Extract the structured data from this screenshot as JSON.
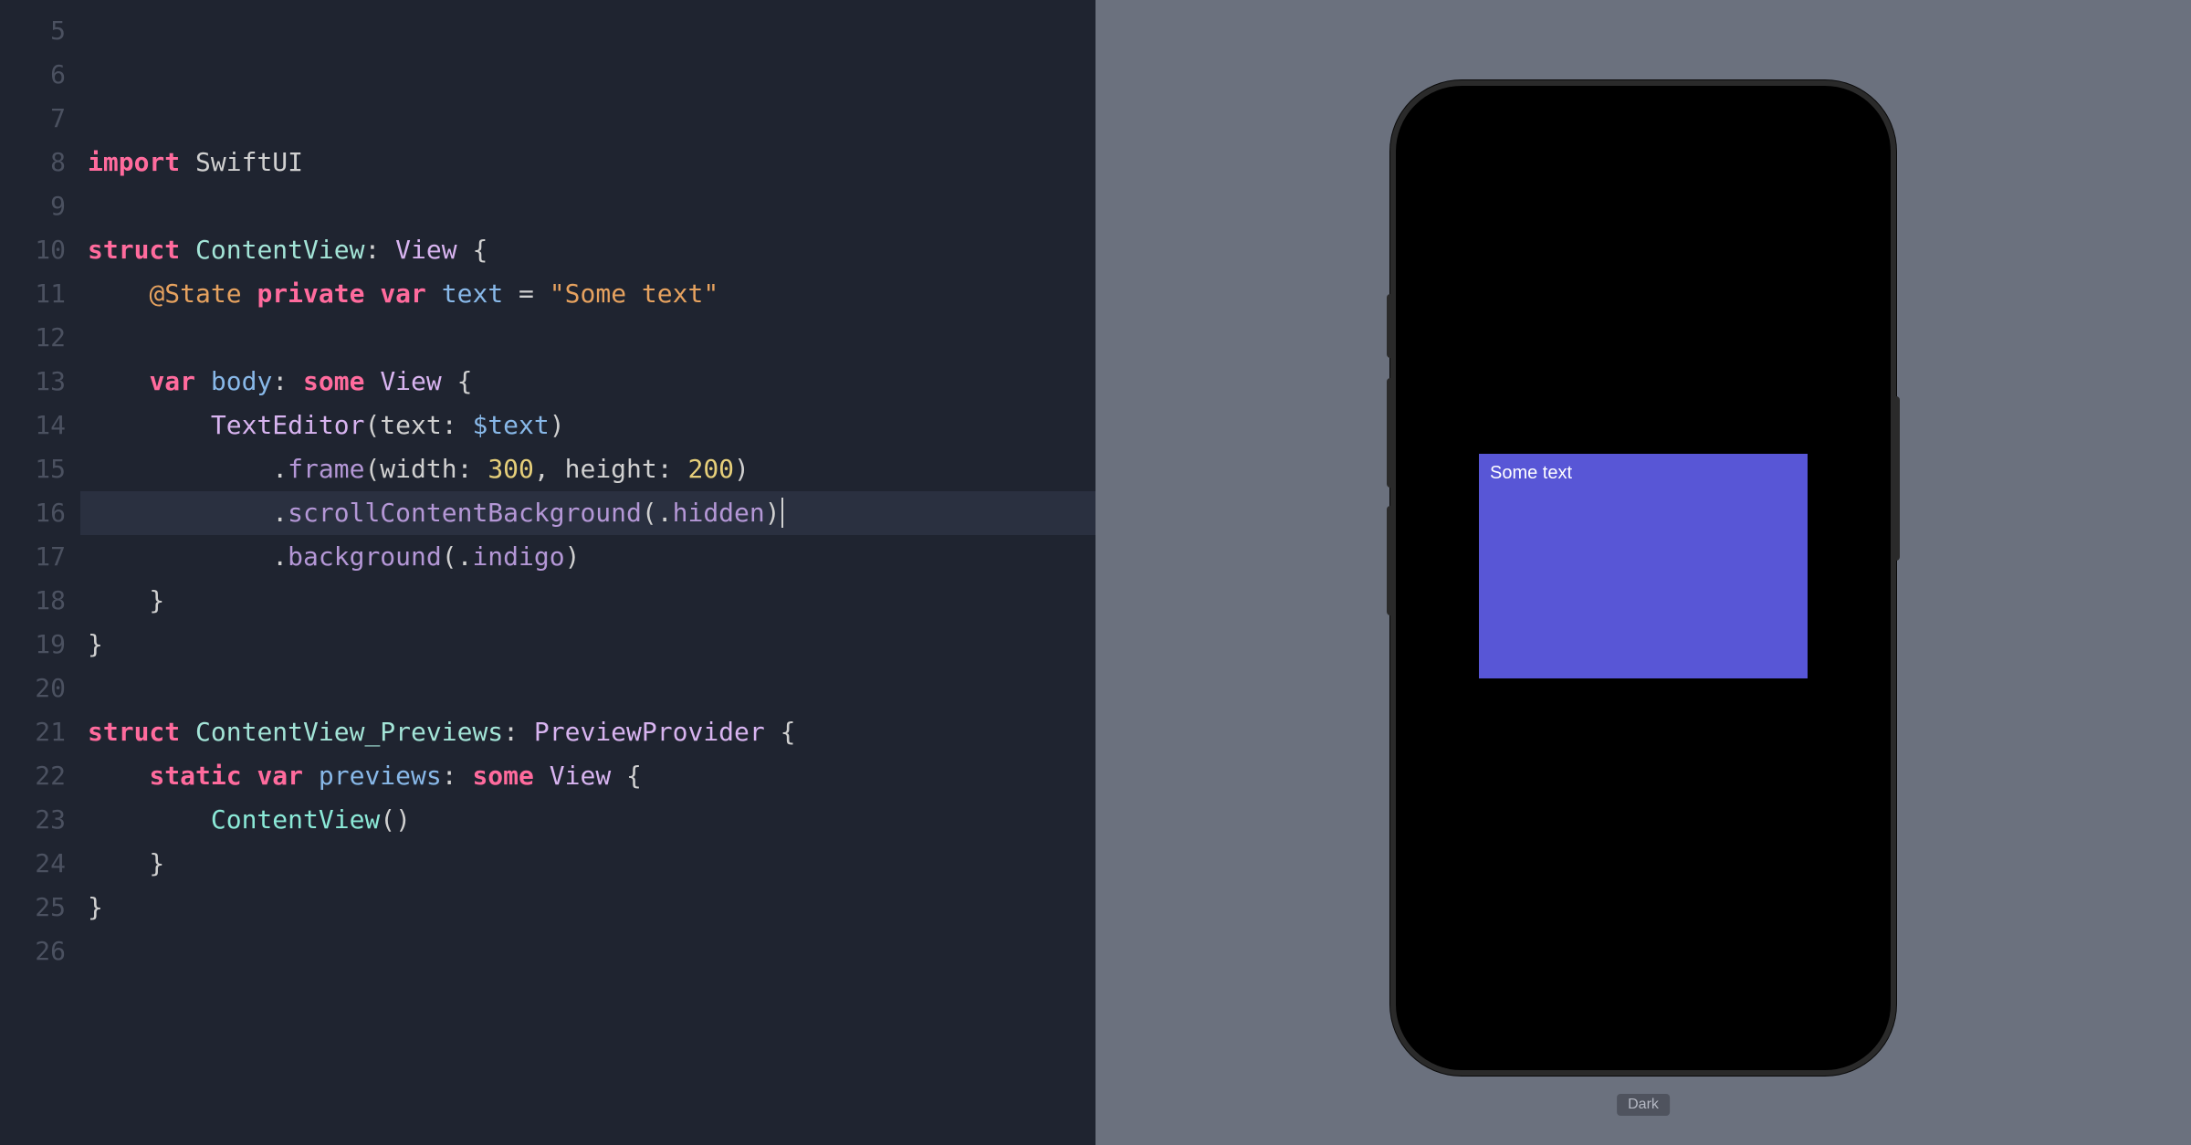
{
  "editor": {
    "first_line_number": 5,
    "highlighted_line": 16,
    "lines": [
      [],
      [],
      [],
      [
        {
          "t": "import ",
          "c": "keyword"
        },
        {
          "t": "SwiftUI",
          "c": "plain"
        }
      ],
      [],
      [
        {
          "t": "struct ",
          "c": "keyword"
        },
        {
          "t": "ContentView",
          "c": "typedecl"
        },
        {
          "t": ": ",
          "c": "op"
        },
        {
          "t": "View",
          "c": "typeref"
        },
        {
          "t": " {",
          "c": "op"
        }
      ],
      [
        {
          "t": "    ",
          "c": "plain"
        },
        {
          "t": "@State",
          "c": "attr"
        },
        {
          "t": " ",
          "c": "plain"
        },
        {
          "t": "private var ",
          "c": "keyword"
        },
        {
          "t": "text",
          "c": "ident"
        },
        {
          "t": " = ",
          "c": "op"
        },
        {
          "t": "\"Some text\"",
          "c": "string"
        }
      ],
      [],
      [
        {
          "t": "    ",
          "c": "plain"
        },
        {
          "t": "var ",
          "c": "keyword"
        },
        {
          "t": "body",
          "c": "ident"
        },
        {
          "t": ": ",
          "c": "op"
        },
        {
          "t": "some ",
          "c": "keyword"
        },
        {
          "t": "View",
          "c": "typeref"
        },
        {
          "t": " {",
          "c": "op"
        }
      ],
      [
        {
          "t": "        ",
          "c": "plain"
        },
        {
          "t": "TextEditor",
          "c": "typeref"
        },
        {
          "t": "(text: ",
          "c": "plain"
        },
        {
          "t": "$text",
          "c": "ident"
        },
        {
          "t": ")",
          "c": "plain"
        }
      ],
      [
        {
          "t": "            .",
          "c": "plain"
        },
        {
          "t": "frame",
          "c": "func"
        },
        {
          "t": "(width: ",
          "c": "plain"
        },
        {
          "t": "300",
          "c": "number"
        },
        {
          "t": ", height: ",
          "c": "plain"
        },
        {
          "t": "200",
          "c": "number"
        },
        {
          "t": ")",
          "c": "plain"
        }
      ],
      [
        {
          "t": "            .",
          "c": "plain"
        },
        {
          "t": "scrollContentBackground",
          "c": "func"
        },
        {
          "t": "(.",
          "c": "plain"
        },
        {
          "t": "hidden",
          "c": "func"
        },
        {
          "t": ")",
          "c": "plain",
          "cursor": true
        }
      ],
      [
        {
          "t": "            .",
          "c": "plain"
        },
        {
          "t": "background",
          "c": "func"
        },
        {
          "t": "(.",
          "c": "plain"
        },
        {
          "t": "indigo",
          "c": "func"
        },
        {
          "t": ")",
          "c": "plain"
        }
      ],
      [
        {
          "t": "    }",
          "c": "op"
        }
      ],
      [
        {
          "t": "}",
          "c": "op"
        }
      ],
      [],
      [
        {
          "t": "struct ",
          "c": "keyword"
        },
        {
          "t": "ContentView_Previews",
          "c": "typedecl"
        },
        {
          "t": ": ",
          "c": "op"
        },
        {
          "t": "PreviewProvider",
          "c": "typeref"
        },
        {
          "t": " {",
          "c": "op"
        }
      ],
      [
        {
          "t": "    ",
          "c": "plain"
        },
        {
          "t": "static var ",
          "c": "keyword"
        },
        {
          "t": "previews",
          "c": "ident"
        },
        {
          "t": ": ",
          "c": "op"
        },
        {
          "t": "some ",
          "c": "keyword"
        },
        {
          "t": "View",
          "c": "typeref"
        },
        {
          "t": " {",
          "c": "op"
        }
      ],
      [
        {
          "t": "        ",
          "c": "plain"
        },
        {
          "t": "ContentView",
          "c": "type"
        },
        {
          "t": "()",
          "c": "plain"
        }
      ],
      [
        {
          "t": "    }",
          "c": "op"
        }
      ],
      [
        {
          "t": "}",
          "c": "op"
        }
      ],
      []
    ]
  },
  "preview": {
    "text_editor_value": "Some text",
    "scheme_label": "Dark",
    "indigo_hex": "#5856d6"
  }
}
